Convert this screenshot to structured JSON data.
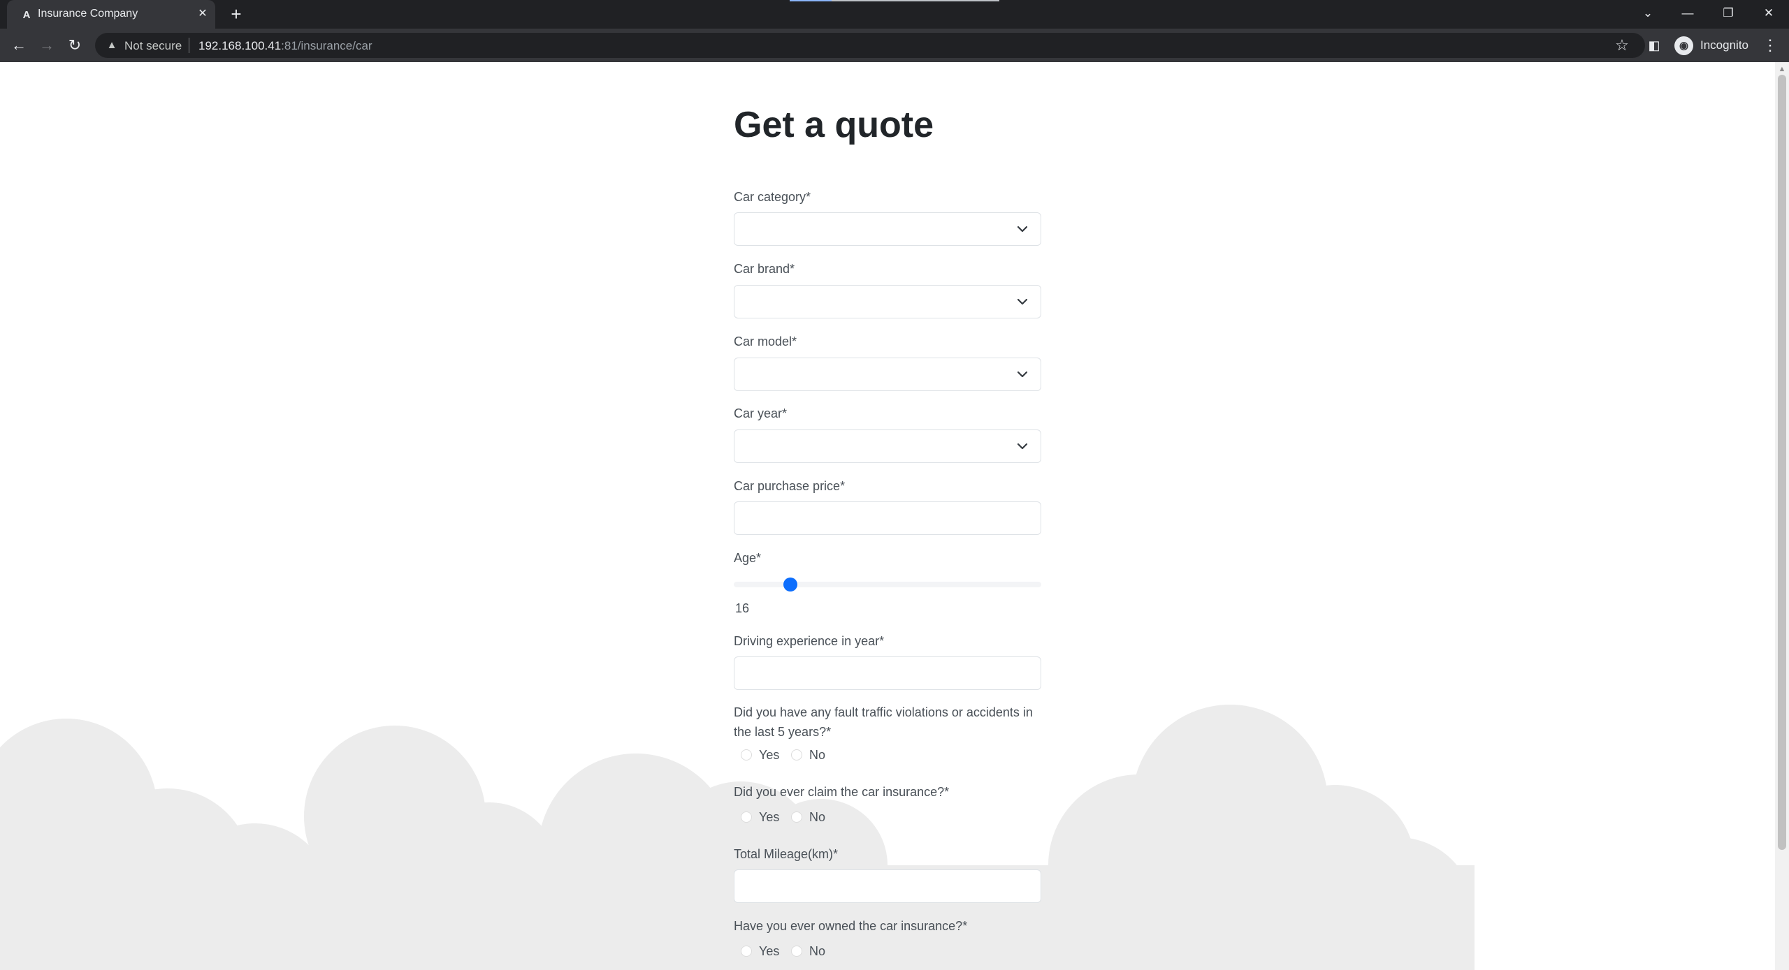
{
  "browser": {
    "tab_title": "Insurance Company",
    "tab_favicon": "A",
    "security_label": "Not secure",
    "url_host": "192.168.100.41",
    "url_rest": ":81/insurance/car",
    "profile_label": "Incognito"
  },
  "page": {
    "title": "Get a quote",
    "fields": {
      "car_category": {
        "label": "Car category*",
        "value": ""
      },
      "car_brand": {
        "label": "Car brand*",
        "value": ""
      },
      "car_model": {
        "label": "Car model*",
        "value": ""
      },
      "car_year": {
        "label": "Car year*",
        "value": ""
      },
      "car_purchase_price": {
        "label": "Car purchase price*",
        "value": ""
      },
      "age": {
        "label": "Age*",
        "value": "16",
        "slider_fraction": 0.17
      },
      "driving_experience": {
        "label": "Driving experience in year*",
        "value": ""
      },
      "violations": {
        "label": "Did you have any fault traffic violations or accidents in the last 5 years?*",
        "options": [
          "Yes",
          "No"
        ],
        "selected": ""
      },
      "claimed": {
        "label": "Did you ever claim the car insurance?*",
        "options": [
          "Yes",
          "No"
        ],
        "selected": ""
      },
      "total_mileage": {
        "label": "Total Mileage(km)*",
        "value": ""
      },
      "owned_insurance": {
        "label": "Have you ever owned the car insurance?*",
        "options": [
          "Yes",
          "No"
        ],
        "selected": ""
      }
    }
  },
  "colors": {
    "accent": "#0d6efd",
    "text": "#495057",
    "cloud": "#ececec",
    "chrome_dark": "#202124",
    "chrome_toolbar": "#35363a"
  },
  "icons": {
    "back": "arrow-left-icon",
    "forward": "arrow-right-icon",
    "reload": "reload-icon",
    "warning": "warning-icon",
    "star": "star-icon",
    "side_panel": "side-panel-icon",
    "incognito": "incognito-icon",
    "menu": "kebab-menu-icon",
    "select": "chevron-down-icon"
  }
}
